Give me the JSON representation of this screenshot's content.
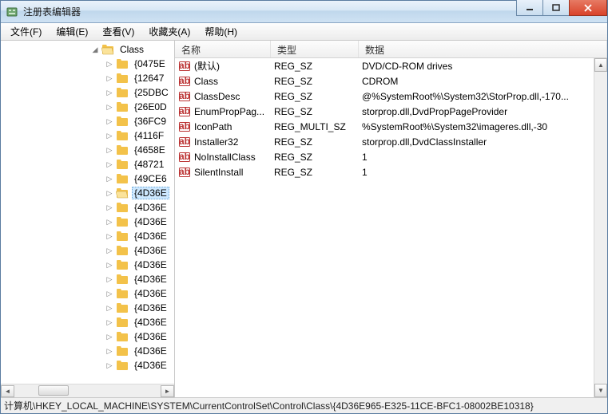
{
  "window": {
    "title": "注册表编辑器"
  },
  "menu": {
    "file": "文件(F)",
    "edit": "编辑(E)",
    "view": "查看(V)",
    "fav": "收藏夹(A)",
    "help": "帮助(H)"
  },
  "tree": {
    "parent_label": "Class",
    "items": [
      {
        "label": "{0475E",
        "selected": false
      },
      {
        "label": "{12647",
        "selected": false
      },
      {
        "label": "{25DBC",
        "selected": false
      },
      {
        "label": "{26E0D",
        "selected": false
      },
      {
        "label": "{36FC9",
        "selected": false
      },
      {
        "label": "{4116F",
        "selected": false
      },
      {
        "label": "{4658E",
        "selected": false
      },
      {
        "label": "{48721",
        "selected": false
      },
      {
        "label": "{49CE6",
        "selected": false
      },
      {
        "label": "{4D36E",
        "selected": true
      },
      {
        "label": "{4D36E",
        "selected": false
      },
      {
        "label": "{4D36E",
        "selected": false
      },
      {
        "label": "{4D36E",
        "selected": false
      },
      {
        "label": "{4D36E",
        "selected": false
      },
      {
        "label": "{4D36E",
        "selected": false
      },
      {
        "label": "{4D36E",
        "selected": false
      },
      {
        "label": "{4D36E",
        "selected": false
      },
      {
        "label": "{4D36E",
        "selected": false
      },
      {
        "label": "{4D36E",
        "selected": false
      },
      {
        "label": "{4D36E",
        "selected": false
      },
      {
        "label": "{4D36E",
        "selected": false
      },
      {
        "label": "{4D36E",
        "selected": false
      }
    ]
  },
  "list": {
    "headers": {
      "name": "名称",
      "type": "类型",
      "data": "数据"
    },
    "rows": [
      {
        "name": "(默认)",
        "type": "REG_SZ",
        "data": "DVD/CD-ROM drives"
      },
      {
        "name": "Class",
        "type": "REG_SZ",
        "data": "CDROM"
      },
      {
        "name": "ClassDesc",
        "type": "REG_SZ",
        "data": "@%SystemRoot%\\System32\\StorProp.dll,-170..."
      },
      {
        "name": "EnumPropPag...",
        "type": "REG_SZ",
        "data": "storprop.dll,DvdPropPageProvider"
      },
      {
        "name": "IconPath",
        "type": "REG_MULTI_SZ",
        "data": "%SystemRoot%\\System32\\imageres.dll,-30"
      },
      {
        "name": "Installer32",
        "type": "REG_SZ",
        "data": "storprop.dll,DvdClassInstaller"
      },
      {
        "name": "NoInstallClass",
        "type": "REG_SZ",
        "data": "1"
      },
      {
        "name": "SilentInstall",
        "type": "REG_SZ",
        "data": "1"
      }
    ]
  },
  "status": {
    "path": "计算机\\HKEY_LOCAL_MACHINE\\SYSTEM\\CurrentControlSet\\Control\\Class\\{4D36E965-E325-11CE-BFC1-08002BE10318}"
  }
}
